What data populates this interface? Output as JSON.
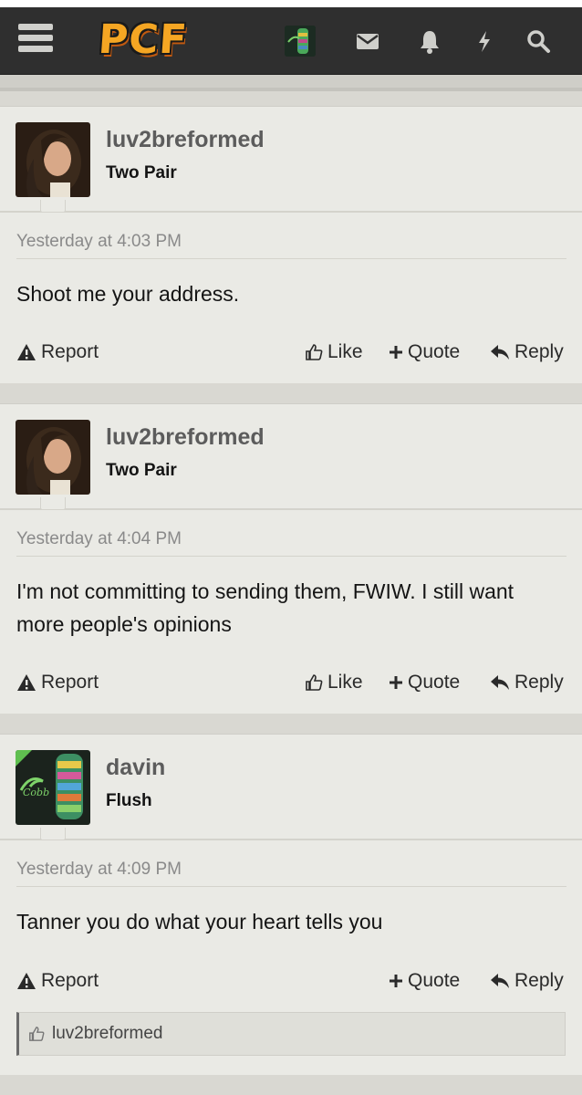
{
  "header": {
    "logo": "PCF",
    "icons": [
      "menu-icon",
      "avatar",
      "envelope-icon",
      "bell-icon",
      "bolt-icon",
      "search-icon"
    ]
  },
  "actions": {
    "report": "Report",
    "like": "Like",
    "quote": "Quote",
    "reply": "Reply"
  },
  "posts": [
    {
      "username": "luv2breformed",
      "title": "Two Pair",
      "date": "Yesterday at 4:03 PM",
      "text": "Shoot me your address."
    },
    {
      "username": "luv2breformed",
      "title": "Two Pair",
      "date": "Yesterday at 4:04 PM",
      "text": "I'm not committing to sending them, FWIW. I still want more people's opinions"
    },
    {
      "username": "davin",
      "title": "Flush",
      "date": "Yesterday at 4:09 PM",
      "text": "Tanner you do what your heart tells you",
      "liked_by": "luv2breformed"
    }
  ],
  "colors": {
    "header_bg": "#2f2f2f",
    "logo": "#f5a623",
    "post_bg": "#eaeae5",
    "page_bg": "#d9d8d2"
  }
}
